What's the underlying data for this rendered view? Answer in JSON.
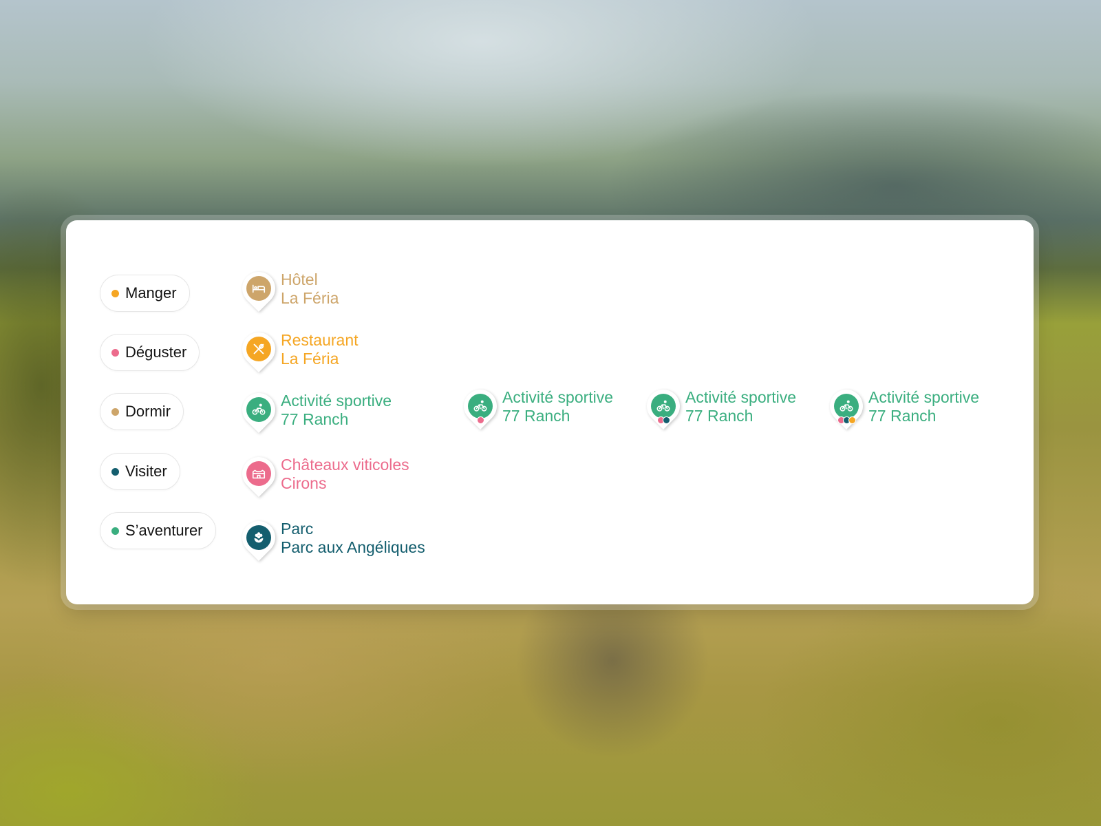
{
  "colors": {
    "manger": "#f5a623",
    "deguster": "#ec6b8c",
    "dormir": "#cda56a",
    "visiter": "#145e6e",
    "aventurer": "#3aae7f"
  },
  "filters": [
    {
      "label": "Manger",
      "color": "#f5a623"
    },
    {
      "label": "Déguster",
      "color": "#ec6b8c"
    },
    {
      "label": "Dormir",
      "color": "#cda56a"
    },
    {
      "label": "Visiter",
      "color": "#145e6e"
    },
    {
      "label": "S’aventurer",
      "color": "#3aae7f"
    }
  ],
  "markers": [
    {
      "title": "Hôtel",
      "subtitle": "La Féria",
      "icon": "bed-icon",
      "color": "#cda56a",
      "dots": []
    },
    {
      "title": "Restaurant",
      "subtitle": "La Féria",
      "icon": "fork-spoon-icon",
      "color": "#f5a623",
      "dots": []
    },
    {
      "title": "Activité sportive",
      "subtitle": "77 Ranch",
      "icon": "cyclist-icon",
      "color": "#3aae7f",
      "dots": []
    },
    {
      "title": "Activité sportive",
      "subtitle": "77 Ranch",
      "icon": "cyclist-icon",
      "color": "#3aae7f",
      "dots": [
        "#ec6b8c"
      ]
    },
    {
      "title": "Activité sportive",
      "subtitle": "77 Ranch",
      "icon": "cyclist-icon",
      "color": "#3aae7f",
      "dots": [
        "#ec6b8c",
        "#145e6e"
      ]
    },
    {
      "title": "Activité sportive",
      "subtitle": "77 Ranch",
      "icon": "cyclist-icon",
      "color": "#3aae7f",
      "dots": [
        "#ec6b8c",
        "#145e6e",
        "#f5a623"
      ]
    },
    {
      "title": "Châteaux viticoles",
      "subtitle": "Cirons",
      "icon": "chateau-icon",
      "color": "#ec6b8c",
      "dots": []
    },
    {
      "title": "Parc",
      "subtitle": "Parc aux Angéliques",
      "icon": "flower-icon",
      "color": "#145e6e",
      "dots": []
    }
  ]
}
